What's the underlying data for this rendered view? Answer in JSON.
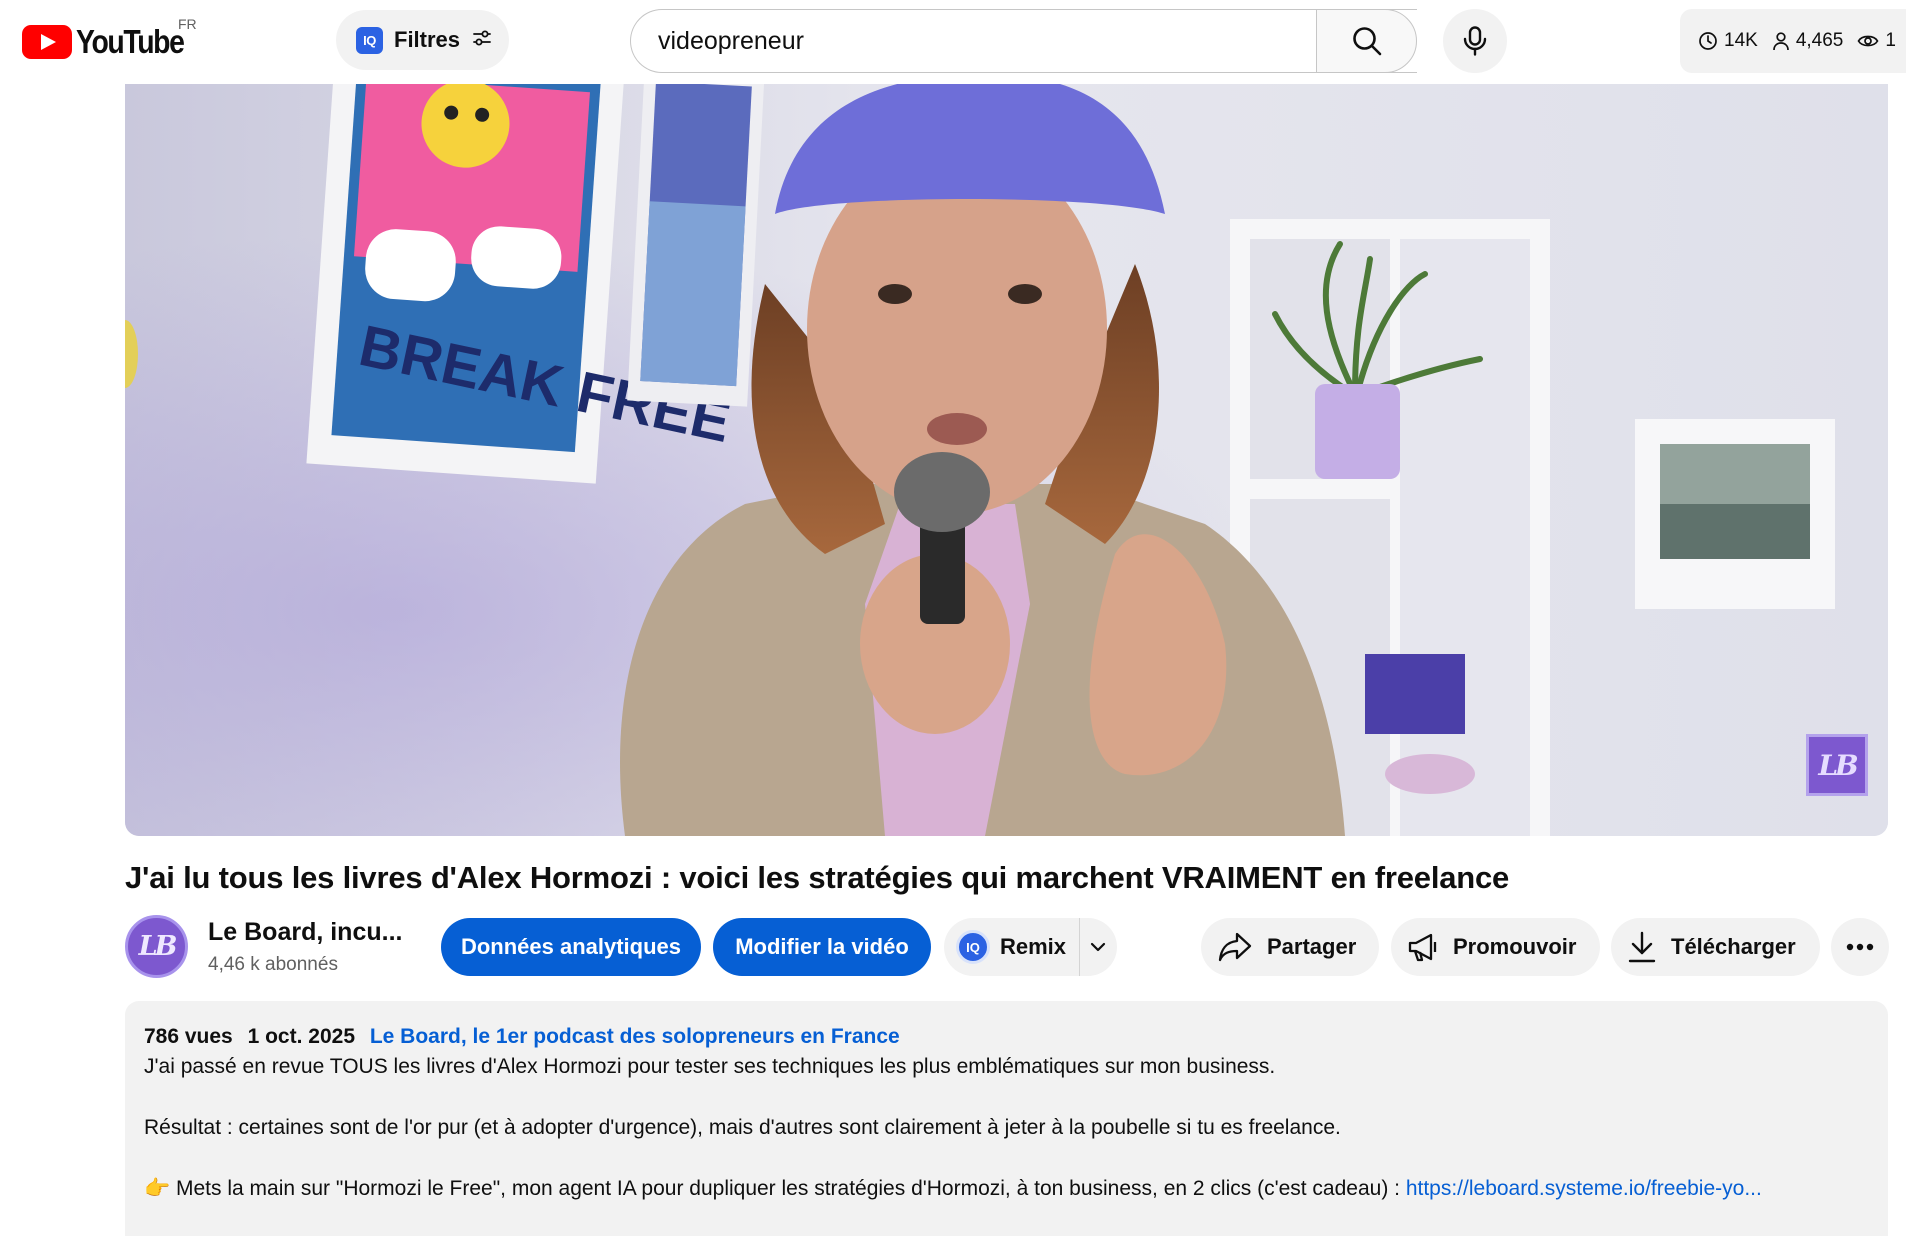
{
  "masthead": {
    "logo_text": "YouTube",
    "country_code": "FR",
    "filters_badge": "IQ",
    "filters_label": "Filtres",
    "search": {
      "value": "videopreneur"
    },
    "stats": {
      "hours": "14K",
      "subscribers": "4,465",
      "views": "1"
    }
  },
  "video": {
    "title": "J'ai lu tous les livres d'Alex Hormozi : voici les stratégies qui marchent VRAIMENT en freelance",
    "watermark": "LB",
    "poster_text": "BREAK FREE"
  },
  "channel": {
    "avatar_text": "LB",
    "name": "Le Board, incu...",
    "subscribers": "4,46 k abonnés"
  },
  "actions": {
    "analytics": "Données analytiques",
    "edit": "Modifier la vidéo",
    "remix_badge": "IQ",
    "remix": "Remix",
    "share": "Partager",
    "promote": "Promouvoir",
    "download": "Télécharger"
  },
  "description": {
    "views": "786 vues",
    "date": "1 oct. 2025",
    "playlist": "Le Board, le 1er podcast des solopreneurs en France",
    "line1": "J'ai passé en revue TOUS les livres d'Alex Hormozi pour tester ses techniques les plus emblématiques sur mon business.",
    "line2": "Résultat : certaines sont de l'or pur (et à adopter d'urgence), mais d'autres sont clairement à jeter à la poubelle si tu es freelance.",
    "line3_emoji": "👉",
    "line3_text": "Mets la main sur \"Hormozi le Free\", mon agent IA pour dupliquer les stratégies d'Hormozi, à ton business, en 2 clics (c'est cadeau) : ",
    "line3_link": "https://leboard.systeme.io/freebie-yo..."
  },
  "colors": {
    "youtube_red": "#ff0000",
    "primary_blue": "#065fd4",
    "iq_blue": "#2b62e3",
    "channel_purple": "#7d58cf",
    "chip_grey": "#f2f2f2"
  }
}
